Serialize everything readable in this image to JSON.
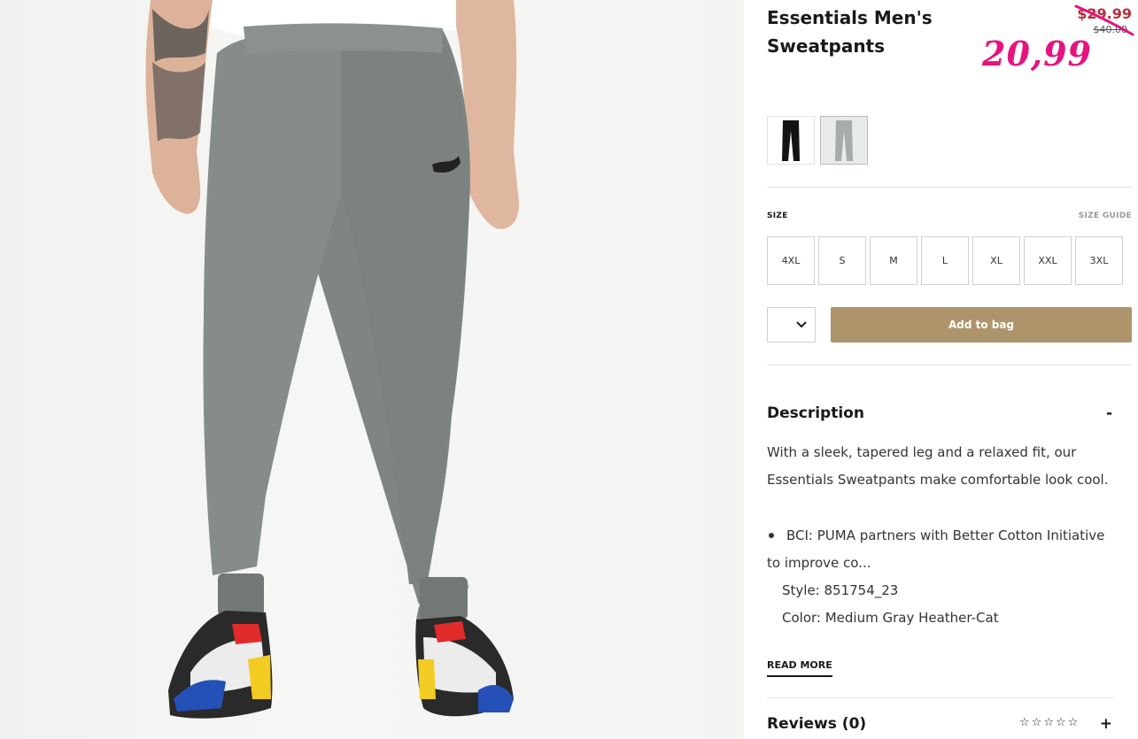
{
  "product": {
    "title": "Essentials Men's Sweatpants",
    "price_current_struck": "$29.99",
    "price_original": "$40.00",
    "price_sale": "20,99"
  },
  "colors": {
    "accent": "#ad946a",
    "sale_price": "#e5137f",
    "old_price": "#ba2b3b",
    "pants_gray": "#7e8481"
  },
  "swatches": [
    {
      "name": "black"
    },
    {
      "name": "medium-gray-heather"
    }
  ],
  "size": {
    "label": "SIZE",
    "guide": "SIZE GUIDE",
    "options": [
      "4XL",
      "S",
      "M",
      "L",
      "XL",
      "XXL",
      "3XL"
    ]
  },
  "cart": {
    "add_label": "Add to bag",
    "qty_icon": "chevron-down-icon"
  },
  "description": {
    "title": "Description",
    "toggle": "-",
    "text": "With a sleek, tapered leg and a relaxed fit, our Essentials Sweatpants make comfortable look cool.",
    "bullet": "BCI: PUMA partners with Better Cotton Initiative to improve co...",
    "style": "Style: 851754_23",
    "color": "Color: Medium Gray Heather-Cat",
    "read_more": "READ MORE"
  },
  "reviews": {
    "title": "Reviews (0)",
    "toggle": "+",
    "rating": 0,
    "max_rating": 5
  }
}
